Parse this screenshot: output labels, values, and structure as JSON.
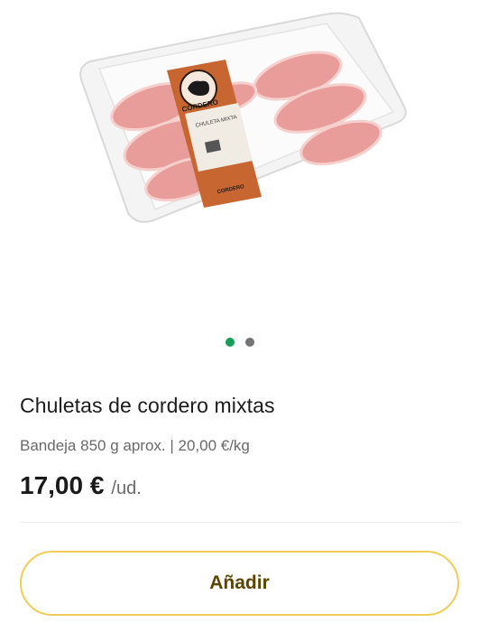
{
  "gallery": {
    "image_label": "product-photo",
    "package_brand": "CORDERO",
    "package_product": "CHULETA MIXTA",
    "package_footer": "CORDERO",
    "active_slide": 1,
    "total_slides": 2
  },
  "product": {
    "name": "Chuletas de cordero mixtas",
    "details": "Bandeja 850 g aprox. | 20,00 €/kg",
    "price": "17,00 €",
    "unit": "/ud."
  },
  "actions": {
    "add_label": "Añadir"
  },
  "colors": {
    "accent_green": "#14a05a",
    "button_border": "#f0cc58",
    "button_text": "#5a4400"
  }
}
